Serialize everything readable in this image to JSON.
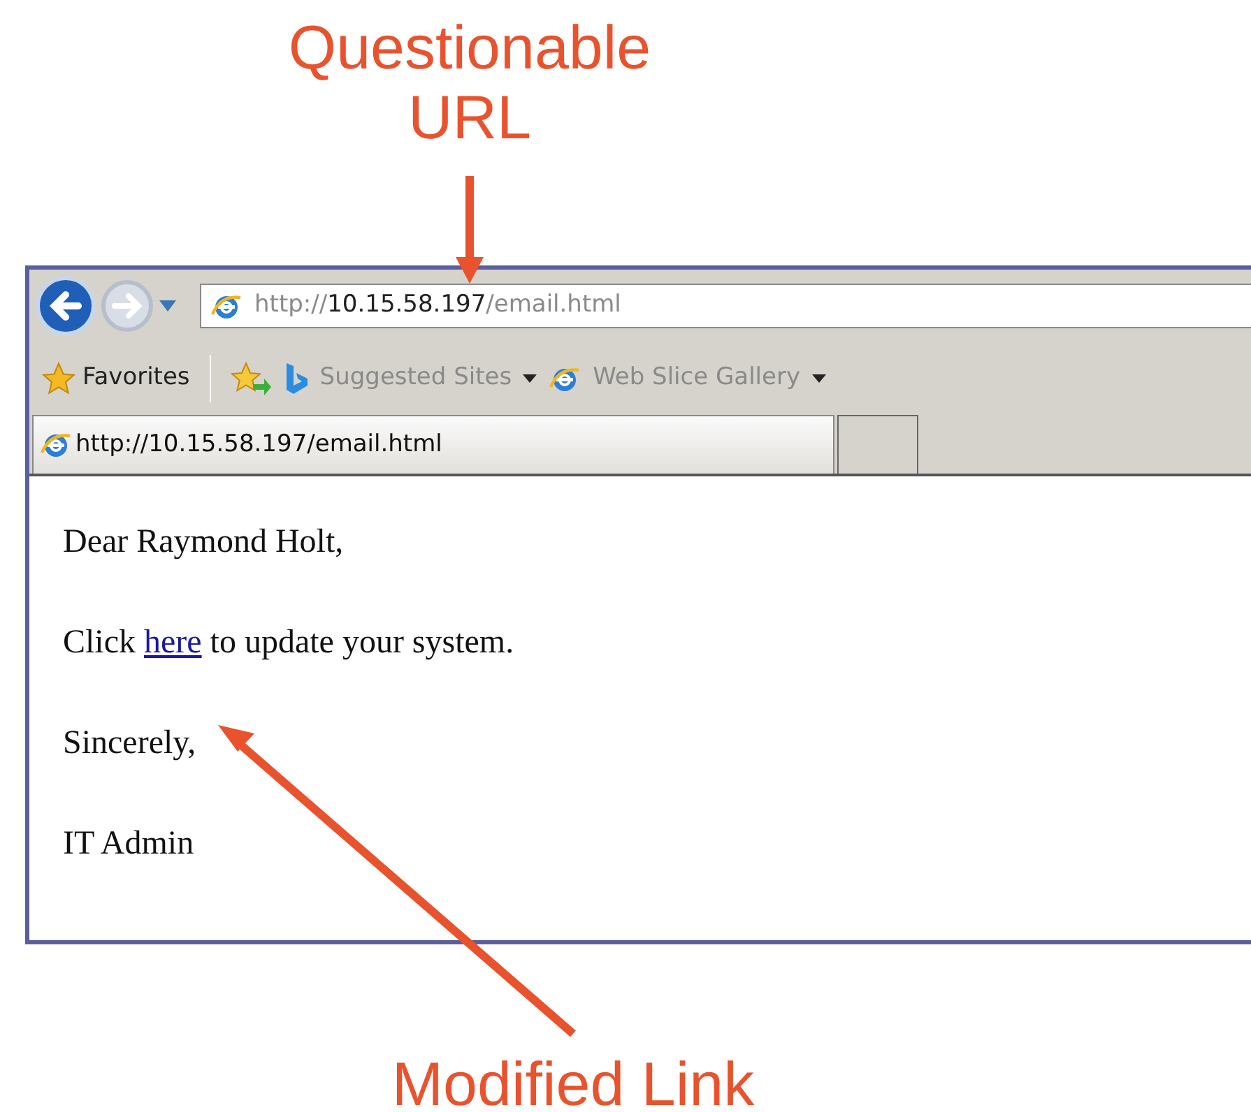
{
  "callouts": [
    {
      "text": "Questionable URL"
    },
    {
      "text": "Modified Link"
    }
  ],
  "browser": {
    "address": "http://**10.15.58.197**/email.html",
    "favorites_label": "Favorites",
    "favorites": [
      {
        "label": "Suggested Sites",
        "kind": "bing"
      },
      {
        "label": "Web Slice Gallery",
        "kind": "ie"
      }
    ],
    "tab": {
      "title": "http://10.15.58.197/email.html",
      "selected": true
    }
  },
  "email": [
    {
      "text": "Dear Raymond Holt,"
    },
    {
      "before": "Click",
      "link": "here",
      "after": "to update your system."
    },
    {
      "text": "Sincerely,"
    },
    {
      "text": "IT Admin"
    }
  ]
}
